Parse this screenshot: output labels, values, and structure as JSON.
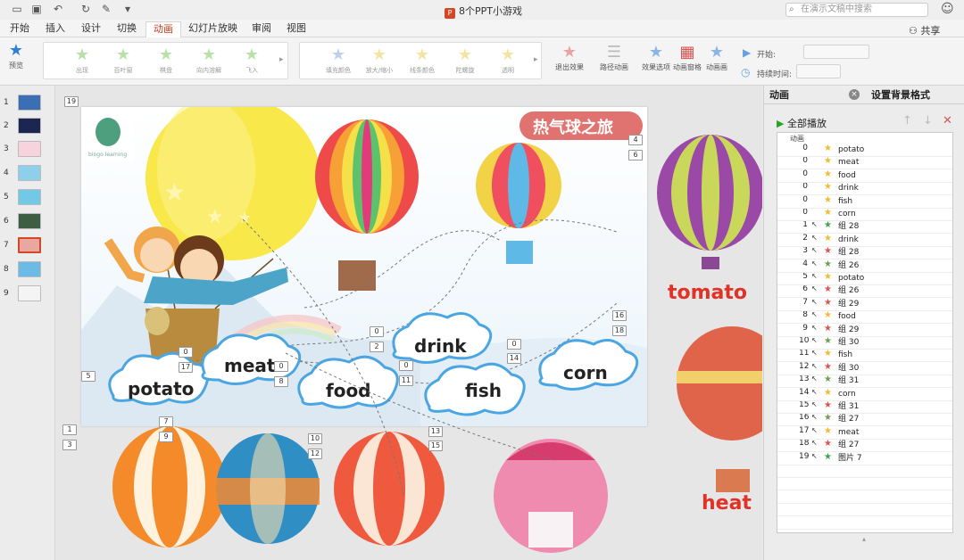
{
  "window": {
    "title": "8个PPT小游戏",
    "search_placeholder": "在演示文稿中搜索"
  },
  "menu": {
    "tabs": [
      "开始",
      "插入",
      "设计",
      "切换",
      "动画",
      "幻灯片放映",
      "审阅",
      "视图"
    ],
    "active": "动画",
    "share": "共享"
  },
  "ribbon": {
    "preview": "预览",
    "entrance_effects": [
      "出现",
      "百叶窗",
      "棋盘",
      "向内溶解",
      "飞入"
    ],
    "emphasis_effects": [
      "填充颜色",
      "放大/缩小",
      "线条颜色",
      "陀螺旋",
      "透明"
    ],
    "buttons": [
      "退出效果",
      "路径动画",
      "效果选项",
      "动画窗格",
      "动画画"
    ],
    "start_label": "开始:",
    "duration_label": "持续时间:"
  },
  "thumbnails": [
    {
      "n": "1",
      "color": "#3a6fb5"
    },
    {
      "n": "2",
      "color": "#1b2750"
    },
    {
      "n": "3",
      "color": "#f6d3dd"
    },
    {
      "n": "4",
      "color": "#8ed0ec"
    },
    {
      "n": "5",
      "color": "#71c9e6"
    },
    {
      "n": "6",
      "color": "#3d5e44"
    },
    {
      "n": "7",
      "color": "#e9a7a0"
    },
    {
      "n": "8",
      "color": "#6bbbe6"
    },
    {
      "n": "9",
      "color": "#f4f4f4"
    }
  ],
  "slide": {
    "title_banner": "热气球之旅",
    "logo_text": "bingo learning",
    "clouds": [
      "potato",
      "meat",
      "food",
      "drink",
      "fish",
      "corn"
    ],
    "outside_words": [
      "tomato",
      "heat"
    ],
    "order_badges": [
      "19",
      "4",
      "6",
      "0",
      "2",
      "0",
      "14",
      "0",
      "17",
      "0",
      "8",
      "5",
      "0",
      "11",
      "16",
      "18",
      "1",
      "3",
      "7",
      "9",
      "10",
      "12",
      "13",
      "15"
    ],
    "colors": {
      "banner": "#e0736f",
      "word_red": "#e03226",
      "cloud_border": "#4aa6e2"
    }
  },
  "panel": {
    "tabs": [
      "动画",
      "设置背景格式"
    ],
    "play_all": "全部播放",
    "list_header": "动画",
    "rows": [
      {
        "order": "0",
        "type": "emph",
        "name": "potato"
      },
      {
        "order": "0",
        "type": "emph",
        "name": "meat"
      },
      {
        "order": "0",
        "type": "emph",
        "name": "food"
      },
      {
        "order": "0",
        "type": "emph",
        "name": "drink"
      },
      {
        "order": "0",
        "type": "emph",
        "name": "fish"
      },
      {
        "order": "0",
        "type": "emph",
        "name": "corn"
      },
      {
        "order": "1",
        "type": "enter",
        "name": "组 28"
      },
      {
        "order": "2",
        "type": "emph",
        "name": "drink"
      },
      {
        "order": "3",
        "type": "exit",
        "name": "组 28"
      },
      {
        "order": "4",
        "type": "path",
        "name": "组 26"
      },
      {
        "order": "5",
        "type": "emph",
        "name": "potato"
      },
      {
        "order": "6",
        "type": "exit",
        "name": "组 26"
      },
      {
        "order": "7",
        "type": "exit",
        "name": "组 29"
      },
      {
        "order": "8",
        "type": "emph",
        "name": "food"
      },
      {
        "order": "9",
        "type": "exit",
        "name": "组 29"
      },
      {
        "order": "10",
        "type": "path",
        "name": "组 30"
      },
      {
        "order": "11",
        "type": "emph",
        "name": "fish"
      },
      {
        "order": "12",
        "type": "exit",
        "name": "组 30"
      },
      {
        "order": "13",
        "type": "path",
        "name": "组 31"
      },
      {
        "order": "14",
        "type": "emph",
        "name": "corn"
      },
      {
        "order": "15",
        "type": "exit",
        "name": "组 31"
      },
      {
        "order": "16",
        "type": "path",
        "name": "组 27"
      },
      {
        "order": "17",
        "type": "emph",
        "name": "meat"
      },
      {
        "order": "18",
        "type": "exit",
        "name": "组 27"
      },
      {
        "order": "19",
        "type": "enter",
        "name": "图片 7"
      }
    ]
  }
}
